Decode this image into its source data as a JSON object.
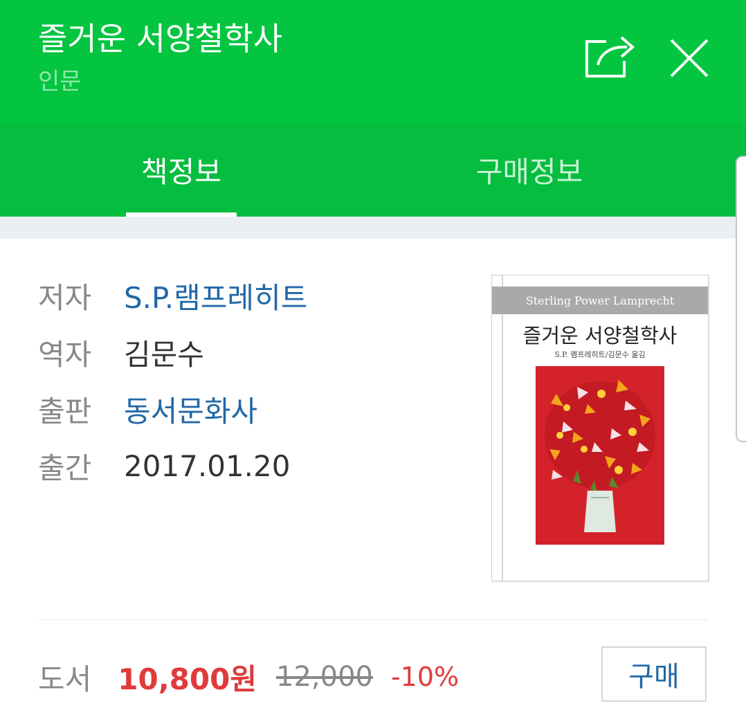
{
  "header": {
    "title": "즐거운 서양철학사",
    "category": "인문",
    "share_icon": "share-icon",
    "close_icon": "close-icon",
    "background": "#03c540"
  },
  "tabs": [
    {
      "label": "책정보",
      "active": true
    },
    {
      "label": "구매정보",
      "active": false
    }
  ],
  "book_info": [
    {
      "label": "저자",
      "value": "S.P.램프레히트",
      "link": true
    },
    {
      "label": "역자",
      "value": "김문수",
      "link": false
    },
    {
      "label": "출판",
      "value": "동서문화사",
      "link": true
    },
    {
      "label": "출간",
      "value": "2017.01.20",
      "link": false
    }
  ],
  "cover": {
    "top_text": "Sterling Power Lamprecht",
    "title": "즐거운 서양철학사",
    "subtitle": "S.P. 램프레히트/김문수 옮김"
  },
  "price": {
    "label": "도서",
    "sale": "10,800원",
    "original": "12,000",
    "discount": "-10%",
    "buy_label": "구매",
    "sale_color": "#e03a3a",
    "link_color": "#2167a7"
  }
}
